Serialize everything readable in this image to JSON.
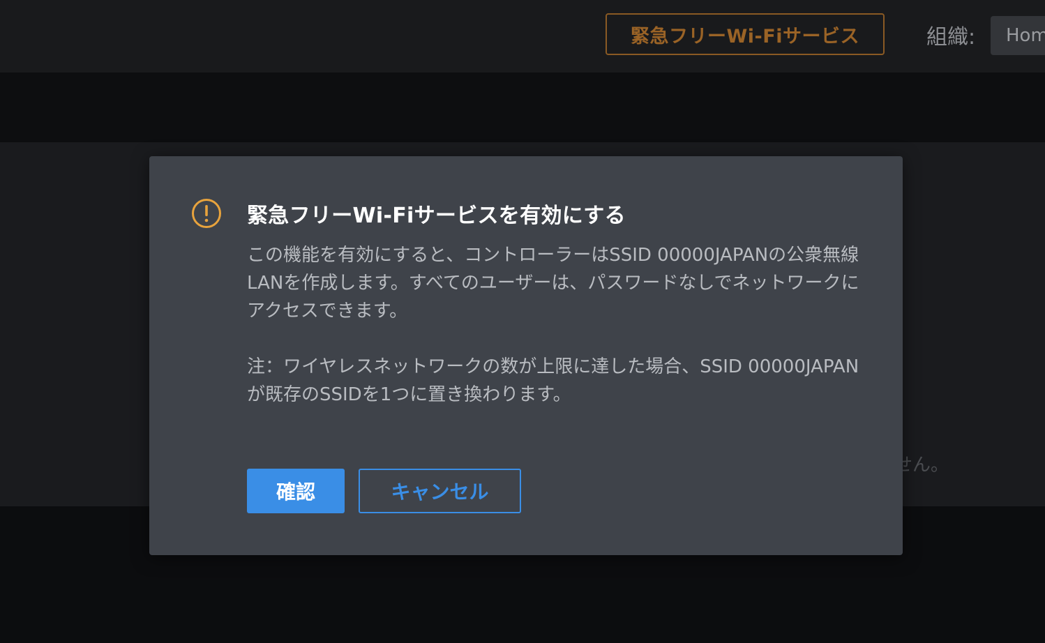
{
  "header": {
    "emergency_button_label": "緊急フリーWi-Fiサービス",
    "org_label": "組織:",
    "org_selected": "Home"
  },
  "background": {
    "partial_text": "せん。"
  },
  "modal": {
    "icon": "warning-circle-icon",
    "icon_color": "#e8a33d",
    "title": "緊急フリーWi-Fiサービスを有効にする",
    "body_paragraph_1": "この機能を有効にすると、コントローラーはSSID 00000JAPANの公衆無線LANを作成します。すべてのユーザーは、パスワードなしでネットワークにアクセスできます。",
    "body_paragraph_2": "注：ワイヤレスネットワークの数が上限に達した場合、SSID 00000JAPANが既存のSSIDを1つに置き換わります。",
    "confirm_label": "確認",
    "cancel_label": "キャンセル"
  },
  "colors": {
    "accent": "#3a8ee6",
    "warning": "#e8a33d",
    "emergency": "#9a6326"
  }
}
